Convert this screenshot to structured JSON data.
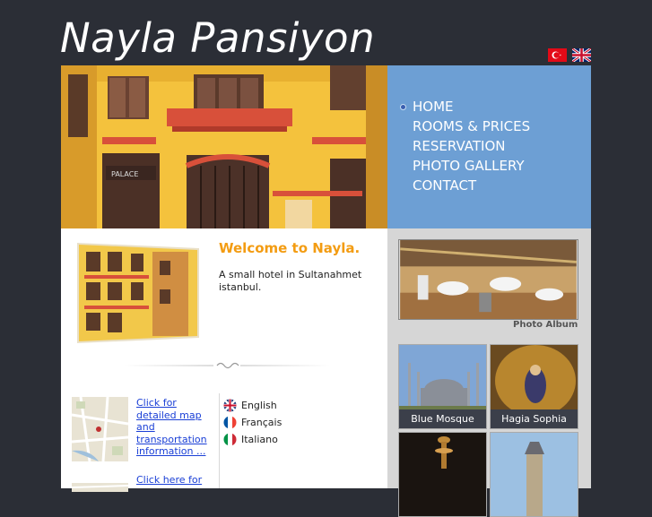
{
  "site": {
    "title": "Nayla Pansiyon"
  },
  "header": {
    "flags": [
      "turkish-flag",
      "english-flag"
    ]
  },
  "nav": {
    "items": [
      "HOME",
      "ROOMS & PRICES",
      "RESERVATION",
      "PHOTO GALLERY",
      "CONTACT"
    ]
  },
  "welcome": {
    "title": "Welcome to Nayla.",
    "text": "A small hotel in Sultanahmet istanbul."
  },
  "links": {
    "map": "Click for detailed map and transportation information ...",
    "here": "Click here for"
  },
  "languages": [
    {
      "label": "English",
      "icon": "english-flag"
    },
    {
      "label": "Français",
      "icon": "french-flag"
    },
    {
      "label": "Italiano",
      "icon": "italian-flag"
    }
  ],
  "sidebar": {
    "album_label": "Photo Album",
    "tiles": [
      "Blue Mosque",
      "Hagia Sophia"
    ]
  },
  "colors": {
    "background": "#2b2e36",
    "nav": "#6d9fd4",
    "welcome_title": "#f39c12",
    "link": "#1a3fd6"
  }
}
